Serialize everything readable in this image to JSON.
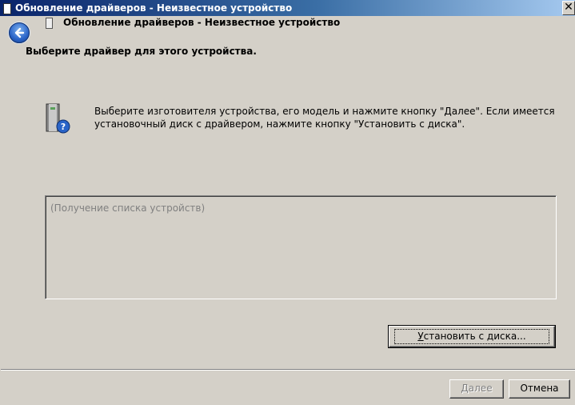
{
  "window": {
    "title": "Обновление драйверов - Неизвестное устройство"
  },
  "nav": {
    "title": "Обновление драйверов - Неизвестное устройство"
  },
  "main": {
    "heading": "Выберите драйвер для этого устройства.",
    "description": "Выберите изготовителя устройства, его модель и нажмите кнопку \"Далее\". Если имеется установочный диск с  драйвером, нажмите кнопку \"Установить с диска\".",
    "list_placeholder": "(Получение списка устройств)"
  },
  "buttons": {
    "install_from_disk_prefix": "",
    "install_from_disk_underlined": "У",
    "install_from_disk_rest": "становить с диска...",
    "next_prefix": "",
    "next_underlined": "Д",
    "next_rest": "алее",
    "next_enabled": false,
    "cancel": "Отмена"
  },
  "icons": {
    "close": "close-icon",
    "back": "back-arrow-icon",
    "device": "unknown-device-icon"
  },
  "colors": {
    "face": "#d4d0c8",
    "title_start": "#0a246a",
    "title_end": "#a6caf0",
    "disabled_text": "#808080"
  }
}
